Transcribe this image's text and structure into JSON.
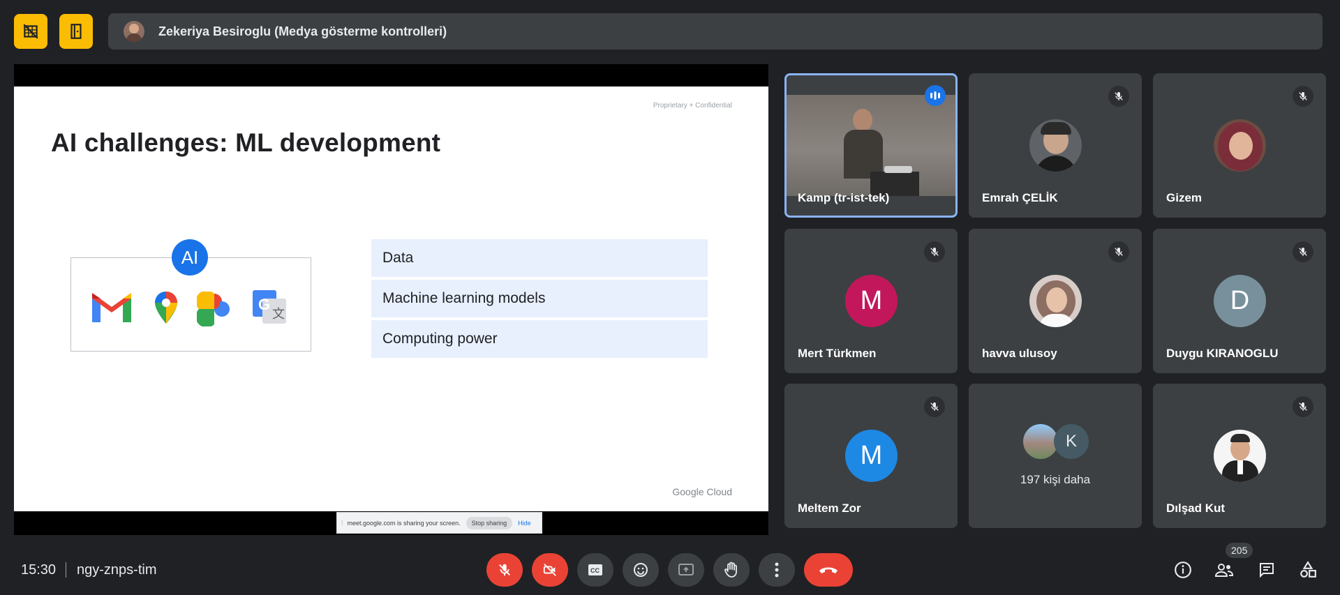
{
  "top_bar": {
    "presenter_label": "Zekeriya Besiroglu (Medya gösterme kontrolleri)"
  },
  "slide": {
    "confidential": "Proprietary + Confidential",
    "title": "AI challenges: ML development",
    "ai_badge": "AI",
    "items": [
      "Data",
      "Machine learning models",
      "Computing power"
    ],
    "footer": "Google Cloud"
  },
  "share_banner": {
    "message": "meet.google.com is sharing your screen.",
    "stop_label": "Stop sharing",
    "hide_label": "Hide"
  },
  "participants": [
    {
      "name": "Kamp (tr-ist-tek)",
      "type": "video",
      "speaking": true
    },
    {
      "name": "Emrah ÇELİK",
      "type": "photo",
      "muted": true
    },
    {
      "name": "Gizem",
      "type": "photo",
      "muted": true
    },
    {
      "name": "Mert Türkmen",
      "type": "initial",
      "initial": "M",
      "color": "#c2185b",
      "muted": true
    },
    {
      "name": "havva ulusoy",
      "type": "photo",
      "muted": true
    },
    {
      "name": "Duygu KIRANOGLU",
      "type": "initial",
      "initial": "D",
      "color": "#78909c",
      "muted": true
    },
    {
      "name": "Meltem Zor",
      "type": "initial",
      "initial": "M",
      "color": "#1e88e5",
      "muted": true
    },
    {
      "name": "Dılşad Kut",
      "type": "photo",
      "muted": true
    }
  ],
  "others_tile": {
    "label": "197 kişi daha",
    "initial": "K"
  },
  "bottom_bar": {
    "time": "15:30",
    "meeting_code": "ngy-znps-tim",
    "participant_count": "205"
  },
  "colors": {
    "background": "#202124",
    "tile": "#3c4043",
    "accent_yellow": "#fbbc04",
    "red": "#ea4335",
    "blue": "#1a73e8",
    "slide_row": "#e8f0fe"
  }
}
